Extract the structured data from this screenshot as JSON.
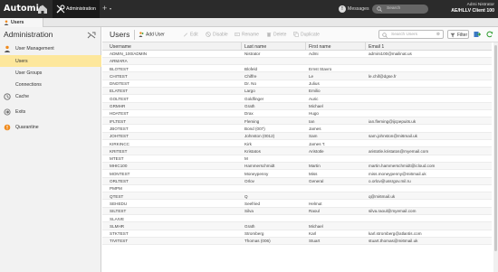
{
  "app": {
    "logo": "Automic",
    "active_tab": "Administration",
    "messages_label": "Messages",
    "search_placeholder": "Search",
    "user_name": "Admi Nistrator",
    "user_client": "AE/HLLV Client 100",
    "plus_label": "+"
  },
  "tabstrip": {
    "tab_label": "Users"
  },
  "sidebar": {
    "title": "Administration",
    "items": [
      {
        "label": "User Management",
        "icon": "user-management-icon"
      },
      {
        "label": "Users",
        "active": true
      },
      {
        "label": "User Groups"
      },
      {
        "label": "Connections"
      },
      {
        "label": "Cache",
        "icon": "cache-icon"
      },
      {
        "label": "Exits",
        "icon": "exits-icon"
      },
      {
        "label": "Quarantine",
        "icon": "quarantine-icon"
      }
    ]
  },
  "toolbar": {
    "title": "Users",
    "add_user": "Add User",
    "edit": "Edit",
    "disable": "Disable",
    "rename": "Rename",
    "delete": "Delete",
    "duplicate": "Duplicate",
    "search_placeholder": "Search Users",
    "filter": "Filter"
  },
  "table": {
    "headers": [
      "Username",
      "Last name",
      "First name",
      "Email 1"
    ],
    "rows": [
      [
        "ADMIN_100/ADMIN",
        "Nistrator",
        "Admi",
        "admini100@mailinat.us"
      ],
      [
        "ARMARA",
        "",
        "",
        ""
      ],
      [
        "BLOTEST",
        "Blofeld",
        "Ernst Stavro",
        ""
      ],
      [
        "CHITEST",
        "Chiffre",
        "Le",
        "le.chif@dgse.fr"
      ],
      [
        "DNOTEST",
        "Dr. No",
        "Julius",
        ""
      ],
      [
        "ELATEST",
        "Largo",
        "Emilio",
        ""
      ],
      [
        "GOLTEST",
        "Goldfinger",
        "Auric",
        ""
      ],
      [
        "GRMHR",
        "Grath",
        "Michael",
        ""
      ],
      [
        "HDATEST",
        "Drax",
        "Hugo",
        ""
      ],
      [
        "IFLTEST",
        "Fleming",
        "Ian",
        "ian.fleming@ijcpepuits.uk"
      ],
      [
        "JBOTEST",
        "Bond (007)",
        "James",
        ""
      ],
      [
        "JOHTEST",
        "Johnston (0012)",
        "Sam",
        "sam.johnston@mi6mail.uk"
      ],
      [
        "KIRKINCC",
        "Kirk",
        "James T.",
        ""
      ],
      [
        "KRITEST",
        "Kristatos",
        "Aristotle",
        "aristotle.kristatos@myemail.com"
      ],
      [
        "MTEST",
        "M",
        "",
        ""
      ],
      [
        "MHIC100",
        "Hammerschmidt",
        "Martin",
        "martin.hammerschmidt@icloud.com"
      ],
      [
        "MONTEST",
        "Moneypenny",
        "Miss",
        "miss.moneypenny@mi6mail.uk"
      ],
      [
        "ORLTEST",
        "Orlov",
        "General",
        "o.orlov@ussrgov.mil.ru"
      ],
      [
        "PMPM",
        "",
        "",
        ""
      ],
      [
        "QTEST",
        "Q",
        "",
        "q@mi6mail.uk"
      ],
      [
        "SEHEDU",
        "Seefried",
        "Helmut",
        ""
      ],
      [
        "SILTEST",
        "Silva",
        "Raoul",
        "silva.raoul@myemail.com"
      ],
      [
        "SLAIVE",
        "",
        "",
        ""
      ],
      [
        "SLMHR",
        "Grath",
        "Michael",
        ""
      ],
      [
        "STKTEST",
        "Stromberg",
        "Karl",
        "karl.stromberg@atlantis.com"
      ],
      [
        "TIVITEST",
        "Thomas (006)",
        "Stuart",
        "stuart.thomas@mi6mail.uk"
      ]
    ]
  },
  "colors": {
    "topbar": "#2b2b2b",
    "sidebar_bg": "#f2f2f2",
    "active_item": "#fde79c",
    "accent_orange": "#f08a1c"
  }
}
